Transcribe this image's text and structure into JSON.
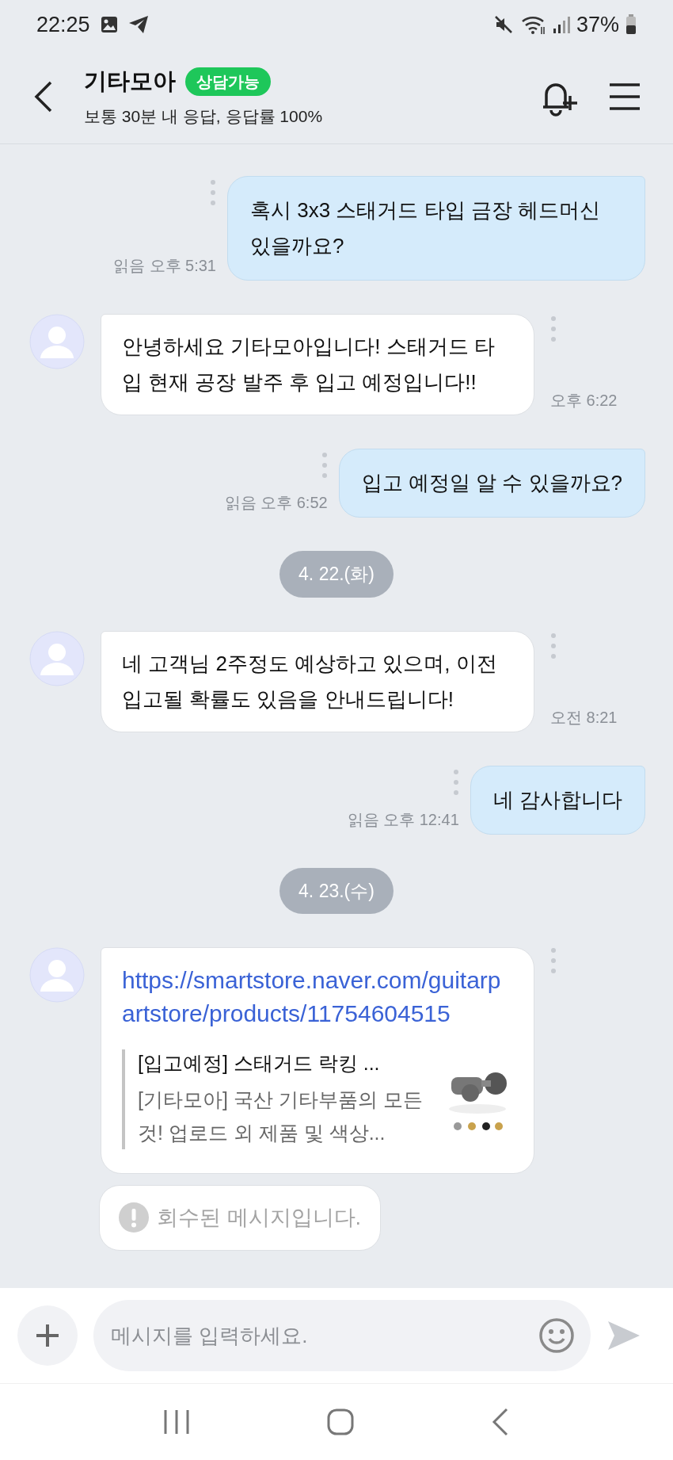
{
  "status_bar": {
    "time": "22:25",
    "battery": "37%"
  },
  "header": {
    "title": "기타모아",
    "badge": "상담가능",
    "subtitle": "보통 30분 내 응답, 응답률 100%"
  },
  "messages": [
    {
      "kind": "sent",
      "text": "혹시 3x3 스태거드 타입 금장 헤드머신 있을까요?",
      "meta": "읽음 오후 5:31"
    },
    {
      "kind": "received",
      "text": "안녕하세요 기타모아입니다! 스태거드 타입 현재 공장 발주 후 입고 예정입니다!!",
      "meta": "오후 6:22"
    },
    {
      "kind": "sent",
      "text": "입고 예정일 알 수 있을까요?",
      "meta": "읽음 오후 6:52"
    },
    {
      "kind": "date",
      "text": "4. 22.(화)"
    },
    {
      "kind": "received",
      "text": "네 고객님 2주정도 예상하고 있으며, 이전 입고될 확률도 있음을 안내드립니다!",
      "meta": "오전 8:21"
    },
    {
      "kind": "sent",
      "text": "네 감사합니다",
      "meta": "읽음 오후 12:41"
    },
    {
      "kind": "date",
      "text": "4. 23.(수)"
    },
    {
      "kind": "link",
      "url": "https://smartstore.naver.com/guitarpartstore/products/11754604515",
      "preview_title": "[입고예정] 스태거드 락킹 ...",
      "preview_description": "[기타모아] 국산 기타부품의 모든 것! 업로드 외 제품 및 색상..."
    },
    {
      "kind": "recalled",
      "text": "회수된 메시지입니다."
    }
  ],
  "composer": {
    "placeholder": "메시지를 입력하세요."
  }
}
